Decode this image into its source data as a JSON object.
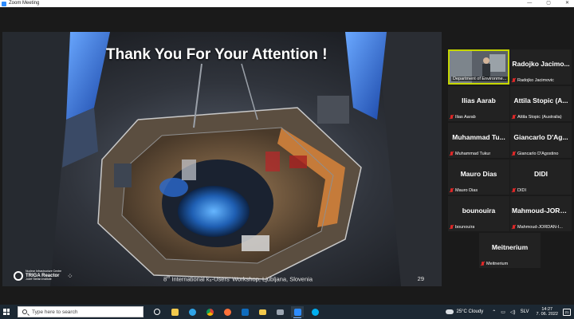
{
  "window": {
    "title": "Zoom Meeting",
    "controls": [
      "—",
      "▢",
      "✕"
    ]
  },
  "slide": {
    "title": "Thank You For Your Attention !",
    "footer_ordinal": "8",
    "footer_sup": "th",
    "footer_text": " International k₀-Users' Workshop, Ljubljana, Slovenia",
    "page_number": "29",
    "logo": {
      "line1": "Nuclear Infrastructure Centre",
      "line2": "TRIGA Reactor",
      "line3": "Jožef Stefan Institute"
    }
  },
  "participants": [
    {
      "name": "",
      "tag": "Department of Environme...",
      "self": true
    },
    {
      "name": "Radojko Jacimo...",
      "tag": "Radojko Jacimovic",
      "self": false
    },
    {
      "name": "Ilias Aarab",
      "tag": "Ilias Aarab",
      "self": false
    },
    {
      "name": "Attila Stopic (A...",
      "tag": "Attila Stopic (Australia)",
      "self": false
    },
    {
      "name": "Muhammad Tu...",
      "tag": "Muhammad Tukur",
      "self": false
    },
    {
      "name": "Giancarlo D'Ag...",
      "tag": "Giancarlo D'Agostino",
      "self": false
    },
    {
      "name": "Mauro Dias",
      "tag": "Mauro Dias",
      "self": false
    },
    {
      "name": "DIDI",
      "tag": "DIDI",
      "self": false
    },
    {
      "name": "bounouira",
      "tag": "bounouira",
      "self": false
    },
    {
      "name": "Mahmoud-JORD...",
      "tag": "Mahmoud-JORDAN-I...",
      "self": false
    },
    {
      "name": "Meitnerium",
      "tag": "Meitnerium",
      "self": false
    }
  ],
  "taskbar": {
    "search_placeholder": "Type here to search",
    "apps": [
      {
        "icon": "task-view-icon",
        "color": "#ffffff"
      },
      {
        "icon": "file-explorer-icon",
        "color": "#f2c94c"
      },
      {
        "icon": "edge-icon",
        "color": "#2fa4e7"
      },
      {
        "icon": "chrome-icon",
        "color": "#e9b32a"
      },
      {
        "icon": "firefox-icon",
        "color": "#ff7139"
      },
      {
        "icon": "outlook-icon",
        "color": "#0f6cbd"
      },
      {
        "icon": "folder-icon",
        "color": "#f2c94c"
      },
      {
        "icon": "mail-icon",
        "color": "#9aa5b1"
      },
      {
        "icon": "zoom-icon",
        "color": "#2d8cff"
      },
      {
        "icon": "skype-icon",
        "color": "#00aff0"
      }
    ],
    "weather": "25°C  Cloudy",
    "language": "SLV",
    "time": "14:27",
    "date": "7. 06. 2022",
    "notifications": "21"
  }
}
